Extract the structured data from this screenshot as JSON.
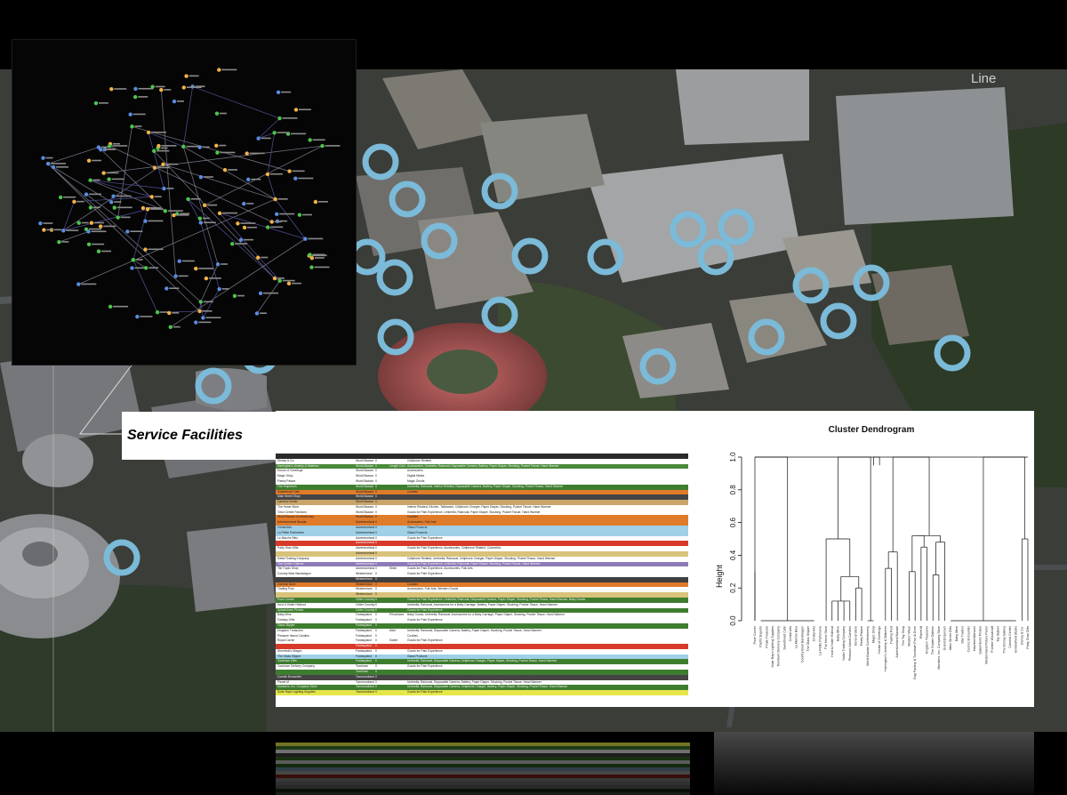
{
  "caption": {
    "label": "Service Facilities"
  },
  "colors": {
    "marker": "#7bbad8",
    "network_background": "#050505",
    "network_edge": "#9a9ab4",
    "network_node_orange": "#f2b24a",
    "network_node_blue": "#5a8de0",
    "network_node_green": "#4cc64c"
  },
  "aerial": {
    "overlay_text": "Line"
  },
  "table": {
    "rows": [
      {
        "name": "",
        "land": "",
        "n": "",
        "note": "",
        "goods": "",
        "color": "#2a2a2a"
      },
      {
        "name": "Disney & Co.",
        "land": "World Bazaar",
        "n": "0",
        "note": "",
        "goods": "Cellphone Related",
        "color": "#ffffff"
      },
      {
        "name": "Harrington's Jewelry & Watches",
        "land": "World Bazaar",
        "n": "0",
        "note": "Length Coin",
        "goods": "Accessories, Umbrella, Raincoat, Disposable Camera, Battery, Paper Diaper, Stocking, Pocket Tissue, Hand Warmer",
        "color": "#4b8a3a"
      },
      {
        "name": "House of Greetings",
        "land": "World Bazaar",
        "n": "0",
        "note": "",
        "goods": "Accessories",
        "color": "#ffffff"
      },
      {
        "name": "Magic Shop",
        "land": "World Bazaar",
        "n": "0",
        "note": "",
        "goods": "Digital Media",
        "color": "#ffffff"
      },
      {
        "name": "Pastry Palace",
        "land": "World Bazaar",
        "n": "0",
        "note": "",
        "goods": "Magic Goods",
        "color": "#ffffff"
      },
      {
        "name": "The Emporium",
        "land": "World Bazaar",
        "n": "0",
        "note": "",
        "goods": "Umbrella, Raincoat, Interior Related, Disposable Camera, Battery, Paper Diaper, Stocking, Pocket Tissue, Hand Warmer",
        "color": "#3e7d2f"
      },
      {
        "name": "Sweetheart Cafe",
        "land": "World Bazaar",
        "n": "0",
        "note": "",
        "goods": "Cookies",
        "color": "#e07b2a"
      },
      {
        "name": "Main Street Shop",
        "land": "World Bazaar",
        "n": "0",
        "note": "",
        "goods": "",
        "color": "#444444"
      },
      {
        "name": "Camera Center",
        "land": "World Bazaar",
        "n": "0",
        "note": "",
        "goods": "",
        "color": "#c9a56a"
      },
      {
        "name": "The Home Store",
        "land": "World Bazaar",
        "n": "0",
        "note": "",
        "goods": "Interior Related, Kitchen, Tableware, Cellphone Charger, Paper Diaper, Stocking, Pocket Tissue, Hand Warmer",
        "color": "#ffffff"
      },
      {
        "name": "Town Center Fashions",
        "land": "World Bazaar",
        "n": "0",
        "note": "",
        "goods": "Goods for Park Experience, Umbrella, Raincoat, Paper Diaper, Stocking, Pocket Tissue, Hand Warmer",
        "color": "#ffffff"
      },
      {
        "name": "World Bazaar Confectionery",
        "land": "World Bazaar",
        "n": "0",
        "note": "",
        "goods": "Cookies",
        "color": "#e07b2a"
      },
      {
        "name": "Adventureland Bazaar",
        "land": "Adventureland",
        "n": "0",
        "note": "",
        "goods": "Accessories, Folk Arts",
        "color": "#e07b2a"
      },
      {
        "name": "Cristal Arts",
        "land": "Adventureland",
        "n": "0",
        "note": "",
        "goods": "Glass Products",
        "color": "#9fd0e8"
      },
      {
        "name": "La Petite Parfumerie",
        "land": "Adventureland",
        "n": "0",
        "note": "",
        "goods": "Glass Products",
        "color": "#9fd0e8"
      },
      {
        "name": "Le Marche Bleu",
        "land": "Adventureland",
        "n": "0",
        "note": "",
        "goods": "Goods for Park Experience",
        "color": "#ffffff"
      },
      {
        "name": "",
        "land": "Adventureland",
        "n": "0",
        "note": "",
        "goods": "",
        "color": "#d83a2a"
      },
      {
        "name": "Party Gras Gifts",
        "land": "Adventureland",
        "n": "0",
        "note": "",
        "goods": "Goods for Park Experience, Accessories, Cellphone Related, Cosmetics",
        "color": "#ffffff"
      },
      {
        "name": "",
        "land": "Adventureland",
        "n": "0",
        "note": "",
        "goods": "",
        "color": "#d9c27a"
      },
      {
        "name": "Safari Trading Company",
        "land": "Adventureland",
        "n": "0",
        "note": "",
        "goods": "Cellphone Related, Umbrella, Raincoat, Cellphone Charger, Paper Diaper, Stocking, Pocket Tissue, Hand Warmer",
        "color": "#ffffff"
      },
      {
        "name": "The Golden Galleon",
        "land": "Adventureland",
        "n": "0",
        "note": "",
        "goods": "Goods for Park Experience, Umbrella, Raincoat, Paper Diaper, Stocking, Pocket Tissue, Hand Warmer",
        "color": "#8f7ab8"
      },
      {
        "name": "Tiki Tropic Shop",
        "land": "Adventureland",
        "n": "0",
        "note": "Stitch",
        "goods": "Goods for Park Experience, Accessories, Folk Arts",
        "color": "#ffffff"
      },
      {
        "name": "Country Bear Bandwagon",
        "land": "Westernland",
        "n": "0",
        "note": "",
        "goods": "Goods for Park Experience",
        "color": "#ffffff"
      },
      {
        "name": "",
        "land": "Westernland",
        "n": "0",
        "note": "",
        "goods": "",
        "color": "#3f3f3f"
      },
      {
        "name": "General Store",
        "land": "Westernland",
        "n": "0",
        "note": "",
        "goods": "Cookies",
        "color": "#e07b2a"
      },
      {
        "name": "Trading Post",
        "land": "Westernland",
        "n": "0",
        "note": "",
        "goods": "Accessories, Folk Arts, Western Goods",
        "color": "#ffffff"
      },
      {
        "name": "",
        "land": "Westernland",
        "n": "0",
        "note": "",
        "goods": "",
        "color": "#d9c27a"
      },
      {
        "name": "Pooh Corner",
        "land": "Critter Country",
        "n": "0",
        "note": "",
        "goods": "Goods for Park Experience, Umbrella, Raincoat, Disposable Camera, Paper Diaper, Stocking, Pocket Tissue, Hand Warmer, Baby Goods",
        "color": "#3e7d2f"
      },
      {
        "name": "Hoot & Holler Hideout",
        "land": "Critter Country",
        "n": "0",
        "note": "",
        "goods": "Umbrella, Raincoat, Accessories for a Baby Carriage, Battery, Paper Diaper, Stocking, Pocket Tissue, Hand Warmer",
        "color": "#ffffff"
      },
      {
        "name": "Splashdown Photos",
        "land": "Critter Country",
        "n": "0",
        "note": "",
        "goods": "Goods for Park Experience",
        "color": "#3e7d2f"
      },
      {
        "name": "Baby Mine",
        "land": "Fantasyland",
        "n": "0",
        "note": "Princesses",
        "goods": "Baby Goods, Umbrella, Raincoat, Accessories for a Baby Carriage, Paper Diaper, Stocking, Pocket Tissue, Hand Warmer",
        "color": "#ffffff"
      },
      {
        "name": "Fantasy Gifts",
        "land": "Fantasyland",
        "n": "0",
        "note": "",
        "goods": "Goods for Park Experience",
        "color": "#ffffff"
      },
      {
        "name": "Glass Slipper",
        "land": "Fantasyland",
        "n": "0",
        "note": "",
        "goods": "",
        "color": "#3e7d2f"
      },
      {
        "name": "Kingdom Treasures",
        "land": "Fantasyland",
        "n": "0",
        "note": "Alice",
        "goods": "Umbrella, Raincoat, Disposable Camera, Battery, Paper Diaper, Stocking, Pocket Tissue, Hand Warmer",
        "color": "#ffffff"
      },
      {
        "name": "Pleasure Island Candies",
        "land": "Fantasyland",
        "n": "0",
        "note": "",
        "goods": "Cookies",
        "color": "#ffffff"
      },
      {
        "name": "Royal Corner",
        "land": "Fantasyland",
        "n": "0",
        "note": "Sweet",
        "goods": "Goods for Park Experience",
        "color": "#ffffff"
      },
      {
        "name": "",
        "land": "Fantasyland",
        "n": "0",
        "note": "",
        "goods": "",
        "color": "#d83a2a"
      },
      {
        "name": "Stromboli's Wagon",
        "land": "Fantasyland",
        "n": "0",
        "note": "",
        "goods": "Goods for Park Experience",
        "color": "#ffffff"
      },
      {
        "name": "The Glass Slipper",
        "land": "Fantasyland",
        "n": "0",
        "note": "",
        "goods": "Glass Products",
        "color": "#9fd0e8"
      },
      {
        "name": "Toontown Gifts",
        "land": "Fantasyland",
        "n": "0",
        "note": "",
        "goods": "Umbrella, Raincoat, Disposable Camera, Cellphone Charger, Paper Diaper, Stocking, Pocket Tissue, Hand Warmer",
        "color": "#3e7d2f"
      },
      {
        "name": "Toontown Delivery Company",
        "land": "Toontown",
        "n": "0",
        "note": "",
        "goods": "Goods for Park Experience",
        "color": "#ffffff"
      },
      {
        "name": "",
        "land": "Toontown",
        "n": "0",
        "note": "",
        "goods": "",
        "color": "#3e7d2f"
      },
      {
        "name": "Cosmic Encounter",
        "land": "Tomorrowland",
        "n": "0",
        "note": "",
        "goods": "",
        "color": "#444444"
      },
      {
        "name": "Planet M",
        "land": "Tomorrowland",
        "n": "0",
        "note": "",
        "goods": "Umbrella, Raincoat, Disposable Camera, Battery, Paper Diaper, Stocking, Pocket Tissue, Hand Warmer",
        "color": "#ffffff"
      },
      {
        "name": "Monsters, Inc. Company Store",
        "land": "Tomorrowland",
        "n": "0",
        "note": "",
        "goods": "Umbrella, Raincoat, Disposable Camera, Cellphone Charger, Battery, Paper Diaper, Stocking, Pocket Tissue, Hand Warmer",
        "color": "#3e7d2f"
      },
      {
        "name": "Solar Ray's Lighting Supplies",
        "land": "Tomorrowland",
        "n": "0",
        "note": "",
        "goods": "Goods for Park Experience",
        "color": "#e6e64a"
      }
    ]
  },
  "chart_data": {
    "type": "dendrogram",
    "title": "Cluster Dendrogram",
    "ylabel": "Height",
    "xlabel": "",
    "ylim": [
      0,
      1
    ],
    "y_ticks": [
      "0.0",
      "0.2",
      "0.4",
      "0.6",
      "0.8",
      "1.0"
    ],
    "leaves": [
      "Pooh Corner",
      "Pacific Exports",
      "Pirate Treasure",
      "Solar Ray's Lighting Supplies",
      "Toontown Delivery Company",
      "Sweetheart Cafe",
      "Cristal Arts",
      "La Marche Bleu",
      "Country Bear Bandwagon",
      "The Glass Slipper",
      "Cristal Arts",
      "La Petite Parfumerie",
      "The Home Store",
      "Hoot & Holler Hideout",
      "Baby Mine",
      "Safari Trading Company",
      "Pleasure Island Candies",
      "General Store",
      "Pastry Palace",
      "World Bazaar Confectionery",
      "Magic Shop",
      "House of Greetings",
      "Harrington's Jewelry & Watches",
      "Trading Post",
      "Adventureland Bazaar",
      "The Toy Shop",
      "Western Wear",
      "Gag Factory & Toontown Five & Dime",
      "Planet M",
      "Kingdom Treasures",
      "The Golden Galleon",
      "Monsters, Inc. Company Store",
      "Grand Emporium",
      "Main Street Gifts",
      "Baby Mine",
      "Star Traders",
      "Cosmic Encounter",
      "Haunted Mansion",
      "Splashdown Photos",
      "Westernland Picture Parlor",
      "Frontier Woodcraft",
      "Toy Station",
      "The Disney Gallery",
      "Camera Center",
      "Bristowfield Studio",
      "Disney & Co.",
      "Party Gras Gifts"
    ]
  }
}
